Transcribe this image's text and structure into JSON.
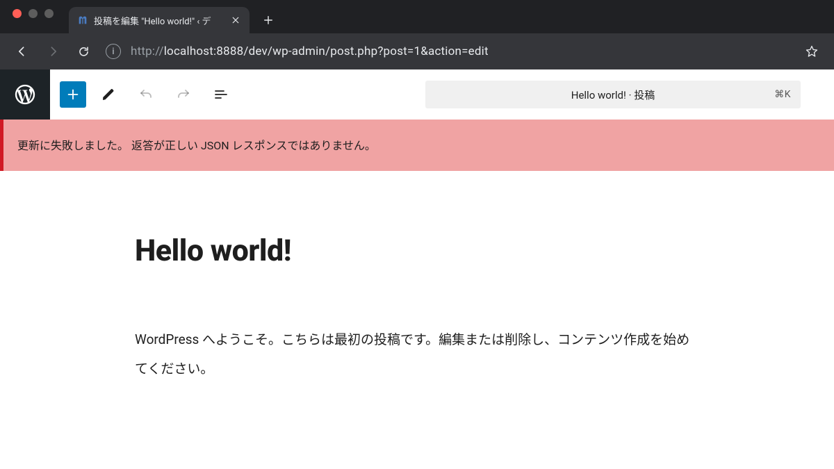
{
  "browser": {
    "tab_title": "投稿を編集 \"Hello world!\" ‹ デ",
    "url_scheme": "http://",
    "url_rest": "localhost:8888/dev/wp-admin/post.php?post=1&action=edit"
  },
  "wp": {
    "doc_bar_text": "Hello world! · 投稿",
    "doc_bar_shortcut": "⌘K",
    "error_message": "更新に失敗しました。 返答が正しい JSON レスポンスではありません。",
    "post_title": "Hello world!",
    "post_paragraph": "WordPress へようこそ。こちらは最初の投稿です。編集または削除し、コンテンツ作成を始めてください。"
  }
}
